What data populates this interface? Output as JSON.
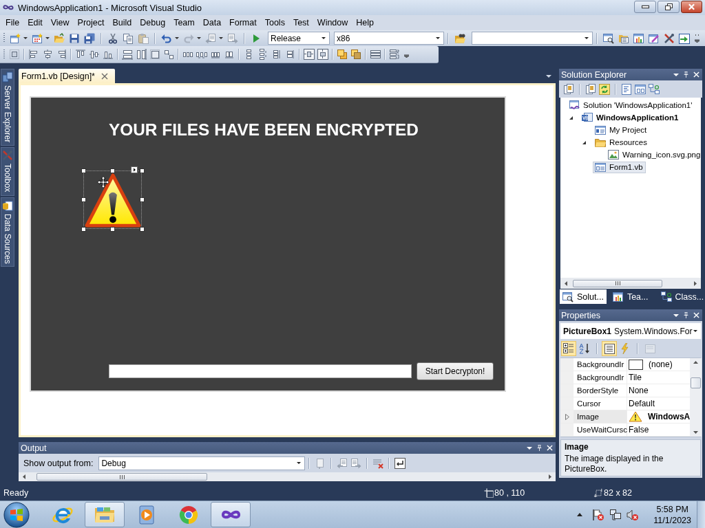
{
  "window": {
    "title": "WindowsApplication1 - Microsoft Visual Studio"
  },
  "menu": [
    "File",
    "Edit",
    "View",
    "Project",
    "Build",
    "Debug",
    "Team",
    "Data",
    "Format",
    "Tools",
    "Test",
    "Window",
    "Help"
  ],
  "toolbar": {
    "configuration": "Release",
    "platform": "x86"
  },
  "side_tabs": [
    {
      "label": "Server Explorer"
    },
    {
      "label": "Toolbox"
    },
    {
      "label": "Data Sources"
    }
  ],
  "document_tab": {
    "label": "Form1.vb [Design]*"
  },
  "form": {
    "heading": "YOUR FILES HAVE BEEN ENCRYPTED",
    "picture_box": {
      "selected": true
    },
    "button": "Start Decrypton!"
  },
  "solution_explorer": {
    "title": "Solution Explorer",
    "tree": [
      {
        "label": "Solution 'WindowsApplication1'",
        "kind": "solution",
        "selected": false,
        "children": [
          {
            "label": "WindowsApplication1",
            "kind": "project",
            "expanded": true,
            "selected": false,
            "children": [
              {
                "label": "My Project",
                "kind": "properties",
                "selected": false
              },
              {
                "label": "Resources",
                "kind": "folder",
                "expanded": true,
                "selected": false,
                "children": [
                  {
                    "label": "Warning_icon.svg.png",
                    "kind": "image",
                    "selected": false
                  }
                ]
              },
              {
                "label": "Form1.vb",
                "kind": "form",
                "selected": true
              }
            ]
          }
        ]
      }
    ],
    "tabs": [
      {
        "label": "Solut...",
        "kind": "solution",
        "selected": true
      },
      {
        "label": "Tea...",
        "kind": "team",
        "selected": false
      },
      {
        "label": "Class...",
        "kind": "class",
        "selected": false
      }
    ]
  },
  "properties": {
    "title": "Properties",
    "object_name": "PictureBox1",
    "object_type": "System.Windows.For",
    "view_buttons": [
      {
        "kind": "categorized",
        "selected": true,
        "disabled": false
      },
      {
        "kind": "alphabetical",
        "selected": false,
        "disabled": false
      },
      {
        "kind": "properties",
        "selected": true,
        "disabled": false
      },
      {
        "kind": "events",
        "selected": false,
        "disabled": false
      },
      {
        "kind": "pages",
        "selected": false,
        "disabled": true
      }
    ],
    "rows": [
      {
        "name": "BackgroundIr",
        "value": "(none)",
        "kind": "swatch",
        "expandable": false,
        "modified": false,
        "selected": false
      },
      {
        "name": "BackgroundIr",
        "value": "Tile",
        "kind": "text",
        "expandable": false,
        "modified": false,
        "selected": false
      },
      {
        "name": "BorderStyle",
        "value": "None",
        "kind": "text",
        "expandable": false,
        "modified": false,
        "selected": false
      },
      {
        "name": "Cursor",
        "value": "Default",
        "kind": "text",
        "expandable": false,
        "modified": false,
        "selected": false
      },
      {
        "name": "Image",
        "value": "WindowsA",
        "kind": "image",
        "expandable": true,
        "modified": true,
        "selected": true
      },
      {
        "name": "UseWaitCursc",
        "value": "False",
        "kind": "text",
        "expandable": false,
        "modified": false,
        "selected": false
      }
    ],
    "description": {
      "title": "Image",
      "text": "The image displayed in the PictureBox."
    }
  },
  "output": {
    "title": "Output",
    "source_label": "Show output from:",
    "source": "Debug"
  },
  "status_bar": {
    "text": "Ready",
    "position": "80 , 110",
    "size": "82 x 82"
  },
  "taskbar": {
    "apps": [
      {
        "kind": "browser",
        "active": false
      },
      {
        "kind": "folder",
        "active": true
      },
      {
        "kind": "player",
        "active": false
      },
      {
        "kind": "round-browser",
        "active": false
      },
      {
        "kind": "infinity",
        "active": true
      }
    ],
    "clock": {
      "time": "5:58 PM",
      "date": "11/1/2023"
    }
  }
}
